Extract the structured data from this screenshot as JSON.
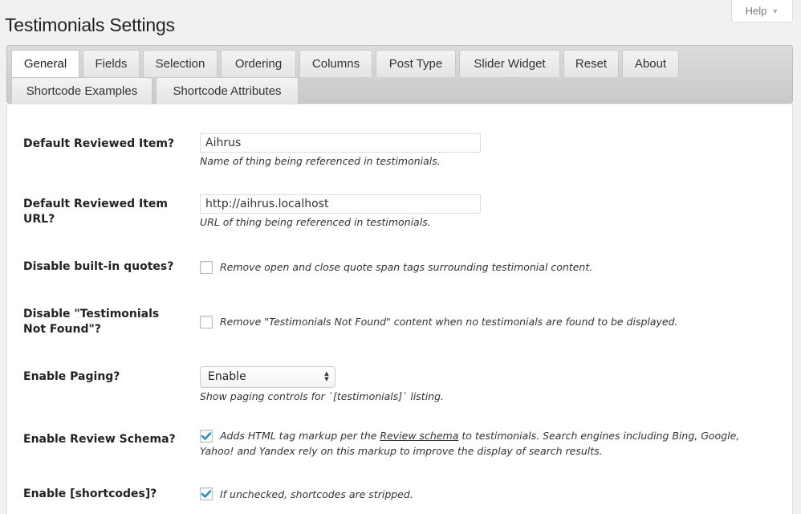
{
  "help": {
    "label": "Help"
  },
  "page": {
    "title": "Testimonials Settings"
  },
  "tabs": [
    {
      "label": "General",
      "active": true
    },
    {
      "label": "Fields"
    },
    {
      "label": "Selection"
    },
    {
      "label": "Ordering"
    },
    {
      "label": "Columns"
    },
    {
      "label": "Post Type"
    },
    {
      "label": "Slider Widget"
    },
    {
      "label": "Reset"
    },
    {
      "label": "About"
    },
    {
      "label": "Shortcode Examples"
    },
    {
      "label": "Shortcode Attributes"
    }
  ],
  "settings": {
    "reviewed_item": {
      "label": "Default Reviewed Item?",
      "value": "Aihrus",
      "description": "Name of thing being referenced in testimonials."
    },
    "reviewed_item_url": {
      "label_line1": "Default Reviewed Item",
      "label_line2": "URL?",
      "value": "http://aihrus.localhost",
      "description": "URL of thing being referenced in testimonials."
    },
    "disable_quotes": {
      "label": "Disable built-in quotes?",
      "checked": false,
      "description": "Remove open and close quote span tags surrounding testimonial content."
    },
    "disable_not_found": {
      "label_line1": "Disable \"Testimonials",
      "label_line2": "Not Found\"?",
      "checked": false,
      "description": "Remove \"Testimonials Not Found\" content when no testimonials are found to be displayed."
    },
    "paging": {
      "label": "Enable Paging?",
      "selected": "Enable",
      "description": "Show paging controls for `[testimonials]` listing."
    },
    "review_schema": {
      "label": "Enable Review Schema?",
      "checked": true,
      "description_pre": "Adds HTML tag markup per the ",
      "description_link": "Review schema",
      "description_post": " to testimonials. Search engines including Bing, Google,",
      "description_line2": "Yahoo! and Yandex rely on this markup to improve the display of search results."
    },
    "shortcodes": {
      "label": "Enable [shortcodes]?",
      "checked": true,
      "description": "If unchecked, shortcodes are stripped."
    }
  },
  "colors": {
    "checkmark": "#1e8cbe",
    "panel": "#d1d1d1",
    "background": "#f1f1f1"
  }
}
